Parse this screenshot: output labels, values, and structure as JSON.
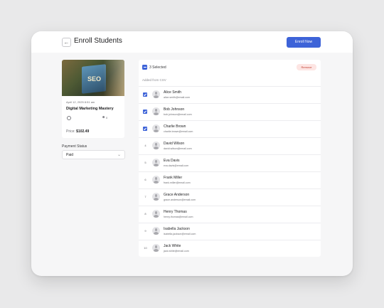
{
  "header": {
    "back_icon": "arrow-left-icon",
    "title": "Enroll Students",
    "enroll_label": "Enroll Now",
    "accent_color": "#3d63d8"
  },
  "course": {
    "thumbnail_text": "SEO",
    "date": "April 12, 2025 8:51 am",
    "name": "Digital Marketing Mastery",
    "clock_icon": "clock-icon",
    "user_icon": "user-icon",
    "enrolled_count": "0",
    "price_label": "Price:",
    "price_value": "$102.49"
  },
  "payment": {
    "label": "Payment Status",
    "selected": "Paid",
    "chevron_icon": "chevron-down-icon"
  },
  "list": {
    "selected_text": "3 Selected",
    "remove_label": "Remove",
    "section_label": "Added from CSV",
    "students": [
      {
        "index": "1",
        "selected": true,
        "name": "Alice Smith",
        "email": "alice.smith@email.com"
      },
      {
        "index": "2",
        "selected": true,
        "name": "Bob Johnson",
        "email": "bob.johnson@email.com"
      },
      {
        "index": "3",
        "selected": true,
        "name": "Charlie Brown",
        "email": "charlie.brown@email.com"
      },
      {
        "index": "4",
        "selected": false,
        "name": "David Wilson",
        "email": "david.wilson@email.com"
      },
      {
        "index": "5",
        "selected": false,
        "name": "Eva Davis",
        "email": "eva.davis@email.com"
      },
      {
        "index": "6",
        "selected": false,
        "name": "Frank Miller",
        "email": "frank.miller@email.com"
      },
      {
        "index": "7",
        "selected": false,
        "name": "Grace Anderson",
        "email": "grace.anderson@email.com"
      },
      {
        "index": "8",
        "selected": false,
        "name": "Henry Thomas",
        "email": "henry.thomas@email.com"
      },
      {
        "index": "9",
        "selected": false,
        "name": "Isabella Jackson",
        "email": "isabella.jackson@email.com"
      },
      {
        "index": "10",
        "selected": false,
        "name": "Jack White",
        "email": "jack.white@email.com"
      }
    ]
  }
}
